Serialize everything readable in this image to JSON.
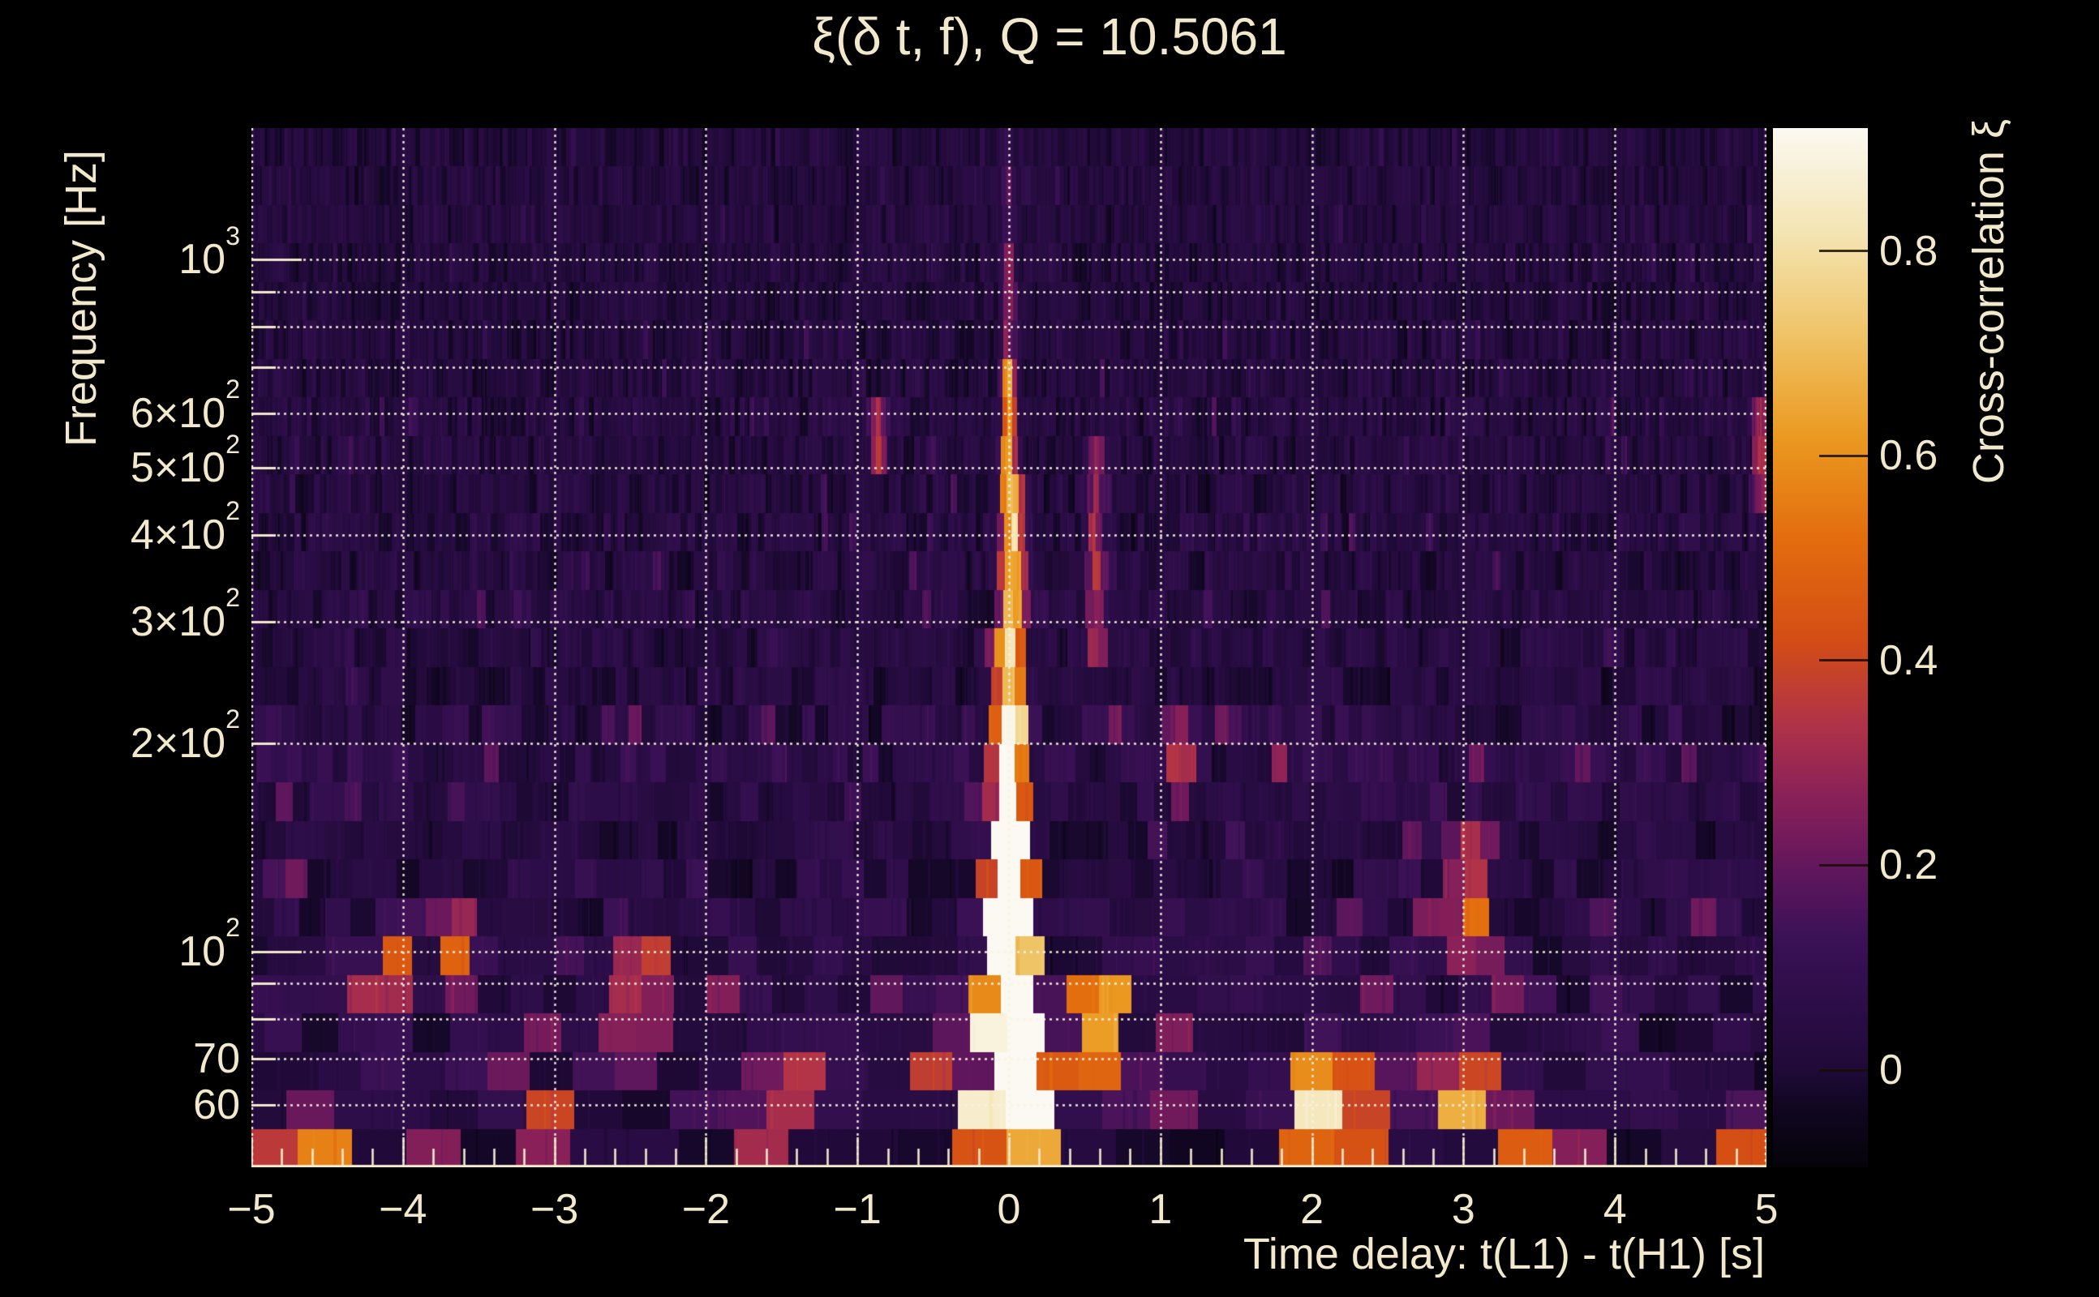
{
  "figure": {
    "background_color": "#000000",
    "text_color": "#f2e9cd",
    "grid_color": "#faf4e0"
  },
  "chart_data": {
    "type": "heatmap",
    "title": "ξ(δ t, f), Q = 10.5061",
    "q_value": 10.5061,
    "xlabel": "Time delay: t(L1) - t(H1) [s]",
    "ylabel": "Frequency [Hz]",
    "colorbar_label": "Cross-correlation ξ",
    "x_range": [
      -5,
      5
    ],
    "x_minor_step": 0.2,
    "y_scale": "log",
    "y_range_hz": [
      48.8,
      1550
    ],
    "grid": true,
    "x_ticks": [
      {
        "value": -5,
        "label": "−5"
      },
      {
        "value": -4,
        "label": "−4"
      },
      {
        "value": -3,
        "label": "−3"
      },
      {
        "value": -2,
        "label": "−2"
      },
      {
        "value": -1,
        "label": "−1"
      },
      {
        "value": 0,
        "label": "0"
      },
      {
        "value": 1,
        "label": "1"
      },
      {
        "value": 2,
        "label": "2"
      },
      {
        "value": 3,
        "label": "3"
      },
      {
        "value": 4,
        "label": "4"
      },
      {
        "value": 5,
        "label": "5"
      }
    ],
    "y_ticks": [
      {
        "value": 1000,
        "base": "10",
        "exp": "3"
      },
      {
        "value": 600,
        "base": "6×10",
        "exp": "2"
      },
      {
        "value": 500,
        "base": "5×10",
        "exp": "2"
      },
      {
        "value": 400,
        "base": "4×10",
        "exp": "2"
      },
      {
        "value": 300,
        "base": "3×10",
        "exp": "2"
      },
      {
        "value": 200,
        "base": "2×10",
        "exp": "2"
      },
      {
        "value": 100,
        "base": "10",
        "exp": "2"
      },
      {
        "value": 70,
        "base": "70",
        "exp": ""
      },
      {
        "value": 60,
        "base": "60",
        "exp": ""
      }
    ],
    "y_gridlines_hz": [
      1000,
      900,
      800,
      700,
      600,
      500,
      400,
      300,
      200,
      100,
      90,
      80,
      70,
      60
    ],
    "colorbar_range": [
      -0.095,
      0.92
    ],
    "colorbar_ticks": [
      {
        "value": 0.8,
        "label": "0.8"
      },
      {
        "value": 0.6,
        "label": "0.6"
      },
      {
        "value": 0.4,
        "label": "0.4"
      },
      {
        "value": 0.2,
        "label": "0.2"
      },
      {
        "value": 0.0,
        "label": "0"
      }
    ],
    "colormap_stops": [
      [
        -0.095,
        "#050309"
      ],
      [
        -0.03,
        "#120724"
      ],
      [
        0.0,
        "#200a38"
      ],
      [
        0.06,
        "#2c0d47"
      ],
      [
        0.13,
        "#3b1156"
      ],
      [
        0.2,
        "#64175d"
      ],
      [
        0.27,
        "#8b2158"
      ],
      [
        0.34,
        "#b13347"
      ],
      [
        0.42,
        "#d44d15"
      ],
      [
        0.52,
        "#e36d0e"
      ],
      [
        0.62,
        "#eb9a21"
      ],
      [
        0.72,
        "#efc468"
      ],
      [
        0.82,
        "#f4e5b4"
      ],
      [
        0.92,
        "#fbf9f1"
      ]
    ],
    "main_ridge": {
      "delay_s": 0.0,
      "components": [
        {
          "dt0": 0.0,
          "sigma_t": 0.022,
          "f_lo": 52,
          "f_hi": 640,
          "amp": 0.62
        },
        {
          "dt0": 0.0,
          "sigma_t": 0.02,
          "f_lo": 640,
          "f_hi": 1050,
          "amp": 0.26
        },
        {
          "dt0": 0.0,
          "sigma_t": 0.02,
          "f_lo": 1050,
          "f_hi": 1500,
          "amp": 0.12
        },
        {
          "dt0": 0.07,
          "sigma_t": 0.018,
          "f_lo": 95,
          "f_hi": 470,
          "amp": 0.34
        },
        {
          "dt0": -0.08,
          "sigma_t": 0.02,
          "f_lo": 95,
          "f_hi": 280,
          "amp": 0.22
        },
        {
          "dt0": 0.0,
          "sigma_t": 0.085,
          "f_lo": 82,
          "f_hi": 140,
          "amp": 0.34
        },
        {
          "dt0": 0.0,
          "sigma_t": 0.15,
          "f_lo": 58,
          "f_hi": 82,
          "amp": 0.22
        },
        {
          "dt0": 0.0,
          "sigma_t": 0.05,
          "f_lo": 140,
          "f_hi": 215,
          "amp": 0.22
        }
      ]
    },
    "hotspots": [
      {
        "dt0": -5.0,
        "sigma_t": 0.04,
        "f_lo": 48,
        "f_hi": 56,
        "amp": 0.3
      },
      {
        "dt0": -4.55,
        "sigma_t": 0.05,
        "f_lo": 48,
        "f_hi": 58,
        "amp": 0.5
      },
      {
        "dt0": -4.05,
        "sigma_t": 0.04,
        "f_lo": 85,
        "f_hi": 110,
        "amp": 0.26
      },
      {
        "dt0": -3.65,
        "sigma_t": 0.05,
        "f_lo": 90,
        "f_hi": 115,
        "amp": 0.24
      },
      {
        "dt0": -3.1,
        "sigma_t": 0.05,
        "f_lo": 48,
        "f_hi": 60,
        "amp": 0.28
      },
      {
        "dt0": -2.42,
        "sigma_t": 0.05,
        "f_lo": 75,
        "f_hi": 100,
        "amp": 0.3
      },
      {
        "dt0": -1.5,
        "sigma_t": 0.06,
        "f_lo": 55,
        "f_hi": 70,
        "amp": 0.24
      },
      {
        "dt0": -0.86,
        "sigma_t": 0.03,
        "f_lo": 480,
        "f_hi": 650,
        "amp": 0.28
      },
      {
        "dt0": 0.6,
        "sigma_t": 0.04,
        "f_lo": 64,
        "f_hi": 88,
        "amp": 0.48
      },
      {
        "dt0": 0.58,
        "sigma_t": 0.03,
        "f_lo": 280,
        "f_hi": 520,
        "amp": 0.26
      },
      {
        "dt0": 1.12,
        "sigma_t": 0.04,
        "f_lo": 170,
        "f_hi": 230,
        "amp": 0.24
      },
      {
        "dt0": 2.03,
        "sigma_t": 0.04,
        "f_lo": 50,
        "f_hi": 72,
        "amp": 0.5
      },
      {
        "dt0": 2.42,
        "sigma_t": 0.04,
        "f_lo": 50,
        "f_hi": 66,
        "amp": 0.4
      },
      {
        "dt0": 2.88,
        "sigma_t": 0.04,
        "f_lo": 58,
        "f_hi": 75,
        "amp": 0.24
      },
      {
        "dt0": 3.06,
        "sigma_t": 0.04,
        "f_lo": 100,
        "f_hi": 145,
        "amp": 0.34
      },
      {
        "dt0": 3.06,
        "sigma_t": 0.05,
        "f_lo": 55,
        "f_hi": 75,
        "amp": 0.3
      },
      {
        "dt0": 3.62,
        "sigma_t": 0.05,
        "f_lo": 48,
        "f_hi": 58,
        "amp": 0.26
      },
      {
        "dt0": 4.97,
        "sigma_t": 0.05,
        "f_lo": 48,
        "f_hi": 58,
        "amp": 0.5
      },
      {
        "dt0": 4.97,
        "sigma_t": 0.03,
        "f_lo": 420,
        "f_hi": 600,
        "amp": 0.26
      }
    ],
    "render_hints": {
      "n_rows": 27,
      "noise_seed": 1337,
      "noise_bands": [
        {
          "f_min": 800,
          "base": 0.02,
          "var": 0.04,
          "p_streak": 0.05,
          "streak_amp": 0.06
        },
        {
          "f_min": 500,
          "base": 0.024,
          "var": 0.048,
          "p_streak": 0.06,
          "streak_amp": 0.07
        },
        {
          "f_min": 300,
          "base": 0.026,
          "var": 0.052,
          "p_streak": 0.06,
          "streak_amp": 0.08
        },
        {
          "f_min": 230,
          "base": 0.03,
          "var": 0.055,
          "p_streak": 0.07,
          "streak_amp": 0.08
        },
        {
          "f_min": 175,
          "base": 0.048,
          "var": 0.075,
          "p_streak": 0.12,
          "streak_amp": 0.11
        },
        {
          "f_min": 130,
          "base": 0.032,
          "var": 0.06,
          "p_streak": 0.08,
          "streak_amp": 0.09
        },
        {
          "f_min": 95,
          "base": 0.038,
          "var": 0.07,
          "p_streak": 0.1,
          "streak_amp": 0.12
        },
        {
          "f_min": 72,
          "base": 0.055,
          "var": 0.085,
          "p_streak": 0.14,
          "streak_amp": 0.13
        },
        {
          "f_min": 56,
          "base": 0.06,
          "var": 0.095,
          "p_streak": 0.15,
          "streak_amp": 0.16
        },
        {
          "f_min": 0,
          "base": 0.01,
          "var": 0.045,
          "p_streak": 0.1,
          "streak_amp": 0.26
        }
      ]
    }
  }
}
